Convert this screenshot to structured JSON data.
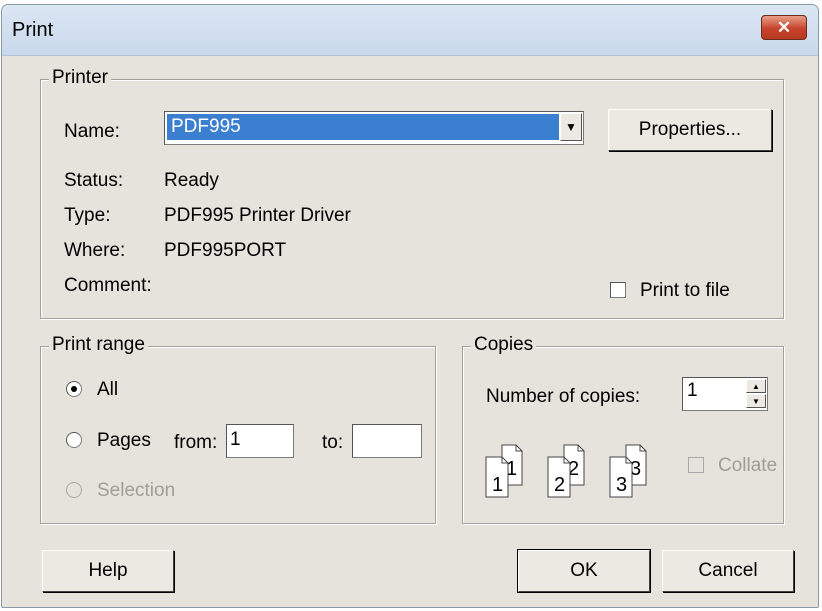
{
  "window": {
    "title": "Print",
    "close_glyph": "✕"
  },
  "printer": {
    "group_label": "Printer",
    "name_label": "Name:",
    "name_value": "PDF995",
    "properties_button": "Properties...",
    "status_label": "Status:",
    "status_value": "Ready",
    "type_label": "Type:",
    "type_value": "PDF995 Printer Driver",
    "where_label": "Where:",
    "where_value": "PDF995PORT",
    "comment_label": "Comment:",
    "print_to_file_label": "Print to file",
    "print_to_file_checked": false
  },
  "print_range": {
    "group_label": "Print range",
    "all_label": "All",
    "pages_label": "Pages",
    "from_label": "from:",
    "from_value": "1",
    "to_label": "to:",
    "to_value": "",
    "selection_label": "Selection",
    "selected": "All"
  },
  "copies": {
    "group_label": "Copies",
    "number_label": "Number of copies:",
    "number_value": "1",
    "collate_label": "Collate",
    "collate_checked": false,
    "collate_pages": [
      "1",
      "1",
      "2",
      "2",
      "3",
      "3"
    ]
  },
  "buttons": {
    "help": "Help",
    "ok": "OK",
    "cancel": "Cancel"
  },
  "colors": {
    "dialog_background": "#e6e3dc",
    "selection_highlight": "#3b7fd0",
    "close_button": "#c7412a"
  }
}
